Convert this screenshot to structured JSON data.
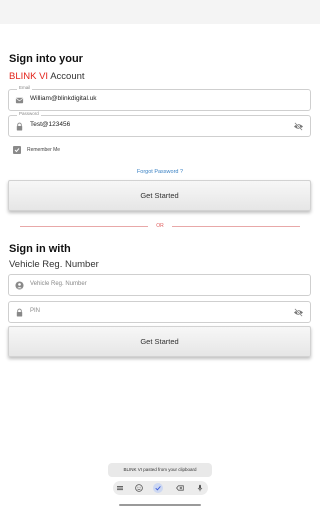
{
  "signin_account": {
    "heading": "Sign into your",
    "brand": "BLINK VI",
    "suffix": " Account",
    "email_label": "Email",
    "email_value": "William@blinkdigital.uk",
    "password_label": "Password",
    "password_value": "Test@123456",
    "remember_label": "Remember Me",
    "remember_checked": true,
    "forgot_label": "Forgot Password ?",
    "button_label": "Get Started"
  },
  "divider": {
    "label": "OR"
  },
  "signin_vehicle": {
    "heading": "Sign in with",
    "subheading": "Vehicle Reg. Number",
    "reg_placeholder": "Vehicle Reg. Number",
    "pin_placeholder": "PIN",
    "button_label": "Get Started"
  },
  "toast": {
    "text": "BLINK VI pasted from your clipboard"
  },
  "keyboard_bar": {
    "icons": [
      "menu-icon",
      "emoji-icon",
      "check-icon",
      "backspace-icon",
      "mic-icon"
    ],
    "accent": "#3b5bdb"
  },
  "colors": {
    "brand_red": "#e2231a",
    "link_blue": "#3b82c4"
  }
}
